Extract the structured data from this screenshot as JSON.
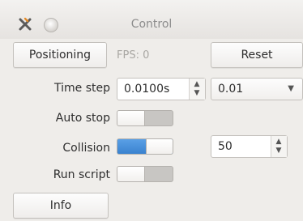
{
  "window": {
    "title": "Control"
  },
  "toolbar": {
    "positioning_label": "Positioning",
    "fps_text": "FPS: 0",
    "reset_label": "Reset"
  },
  "time_step": {
    "label": "Time step",
    "spin_value": "0.0100s",
    "combo_value": "0.01"
  },
  "auto_stop": {
    "label": "Auto stop",
    "state": "off"
  },
  "collision": {
    "label": "Collision",
    "state": "on",
    "spin_value": "50"
  },
  "run_script": {
    "label": "Run script",
    "state": "off"
  },
  "footer": {
    "info_label": "Info"
  },
  "colors": {
    "accent": "#4a90d9",
    "window_bg": "#efedea"
  }
}
